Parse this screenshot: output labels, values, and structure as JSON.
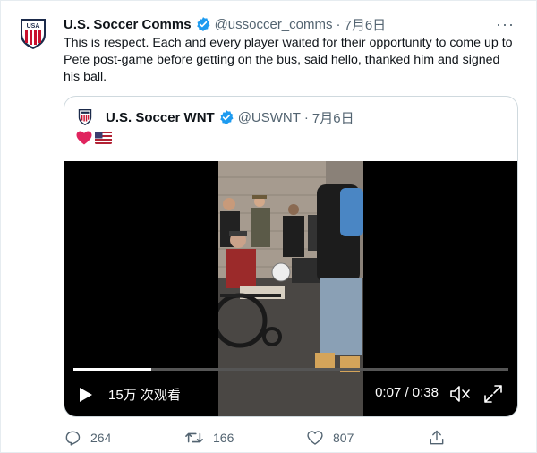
{
  "tweet": {
    "author_name": "U.S. Soccer Comms",
    "handle": "@ussoccer_comms",
    "separator": "·",
    "date": "7月6日",
    "text": "This is respect. Each and every player waited for their opportunity to come up to Pete post-game before getting on the bus, said hello, thanked him and signed his ball."
  },
  "quoted": {
    "author_name": "U.S. Soccer WNT",
    "handle": "@USWNT",
    "separator": "·",
    "date": "7月6日"
  },
  "video": {
    "progress": 0.18,
    "views": "15万 次观看",
    "time": "0:07 / 0:38"
  },
  "actions": {
    "reply_count": "264",
    "retweet_count": "166",
    "like_count": "807"
  },
  "colors": {
    "verified": "#1d9bf0",
    "text": "#0f1419",
    "muted": "#536471"
  }
}
